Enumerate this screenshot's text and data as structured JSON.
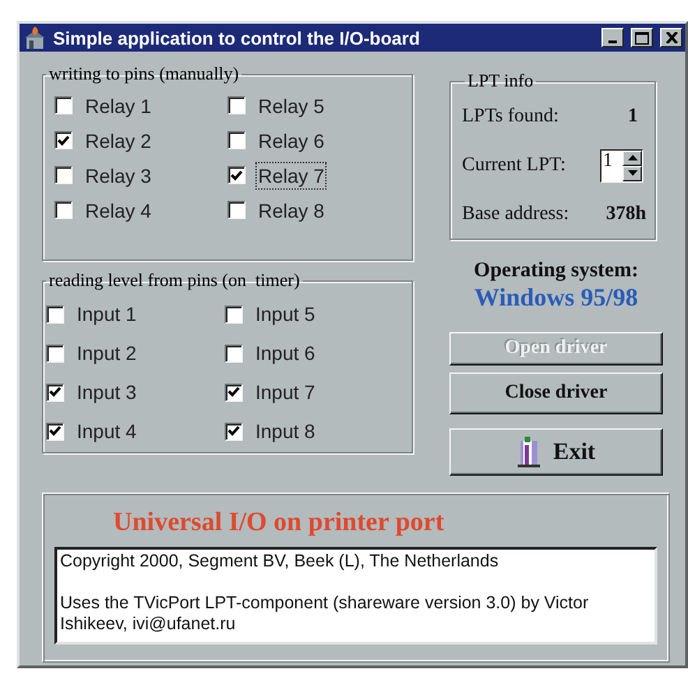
{
  "window": {
    "title": "Simple application to control the I/O-board"
  },
  "relays": {
    "title": "writing to pins (manually)",
    "items": [
      {
        "label": "Relay 1",
        "checked": false,
        "focused": false
      },
      {
        "label": "Relay 2",
        "checked": true,
        "focused": false
      },
      {
        "label": "Relay 3",
        "checked": false,
        "focused": false
      },
      {
        "label": "Relay 4",
        "checked": false,
        "focused": false
      },
      {
        "label": "Relay 5",
        "checked": false,
        "focused": false
      },
      {
        "label": "Relay 6",
        "checked": false,
        "focused": false
      },
      {
        "label": "Relay 7",
        "checked": true,
        "focused": true
      },
      {
        "label": "Relay 8",
        "checked": false,
        "focused": false
      }
    ]
  },
  "inputs": {
    "title": "reading level from pins (on  timer)",
    "items": [
      {
        "label": "Input 1",
        "checked": false
      },
      {
        "label": "Input 2",
        "checked": false
      },
      {
        "label": "Input 3",
        "checked": true
      },
      {
        "label": "Input 4",
        "checked": true
      },
      {
        "label": "Input 5",
        "checked": false
      },
      {
        "label": "Input 6",
        "checked": false
      },
      {
        "label": "Input 7",
        "checked": true
      },
      {
        "label": "Input 8",
        "checked": true
      }
    ]
  },
  "lpt_info": {
    "title": "LPT info",
    "lpts_found_label": "LPTs found:",
    "lpts_found": "1",
    "current_lpt_label": "Current LPT:",
    "current_lpt": "1",
    "base_address_label": "Base address:",
    "base_address": "378h"
  },
  "operating_system": {
    "label": "Operating system:",
    "value": "Windows 95/98"
  },
  "buttons": [
    {
      "label": "Open driver",
      "disabled": true,
      "kind": "text"
    },
    {
      "label": "Close driver",
      "disabled": false,
      "kind": "text"
    },
    {
      "label": "Exit",
      "disabled": false,
      "kind": "exit"
    }
  ],
  "about": {
    "heading": "Universal I/O on printer port",
    "paragraphs": [
      "Copyright 2000, Segment BV, Beek (L), The Netherlands",
      "Uses the TVicPort LPT-component (shareware version 3.0) by Victor Ishikeev, ivi@ufanet.ru"
    ]
  }
}
